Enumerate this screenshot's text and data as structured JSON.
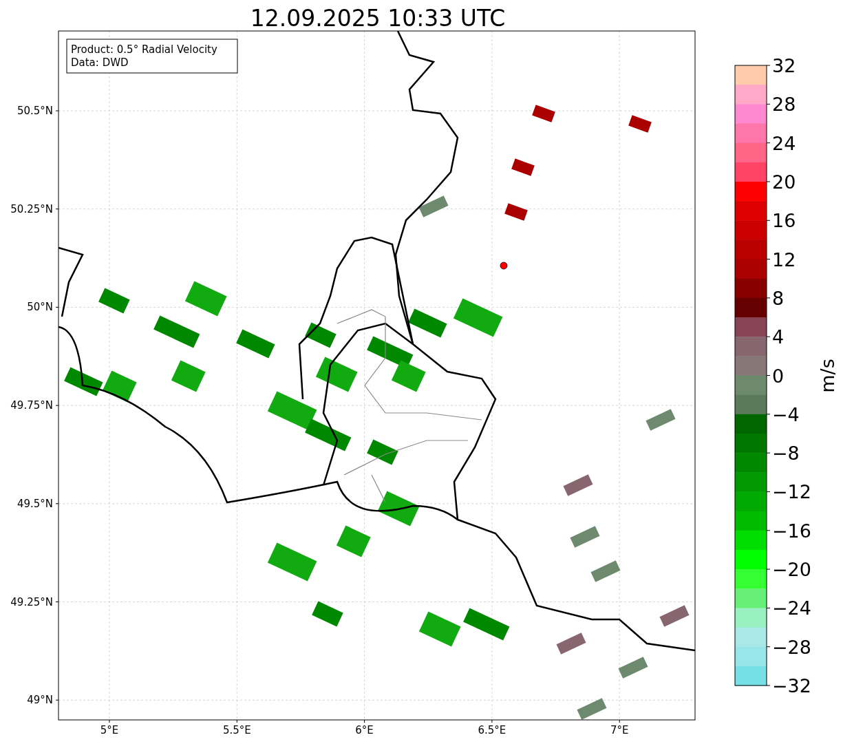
{
  "title": "12.09.2025 10:33 UTC",
  "info_box": [
    "Product: 0.5° Radial Velocity",
    "Data: DWD"
  ],
  "y_ticks": [
    "50.5°N",
    "50.25°N",
    "50°N",
    "49.75°N",
    "49.5°N",
    "49.25°N",
    "49°N"
  ],
  "x_ticks": [
    "5°E",
    "5.5°E",
    "6°E",
    "6.5°E",
    "7°E"
  ],
  "colorbar": {
    "label": "m/s",
    "ticks": [
      "32",
      "28",
      "24",
      "20",
      "16",
      "12",
      "8",
      "4",
      "0",
      "−4",
      "−8",
      "−12",
      "−16",
      "−20",
      "−24",
      "−28",
      "−32"
    ]
  }
}
